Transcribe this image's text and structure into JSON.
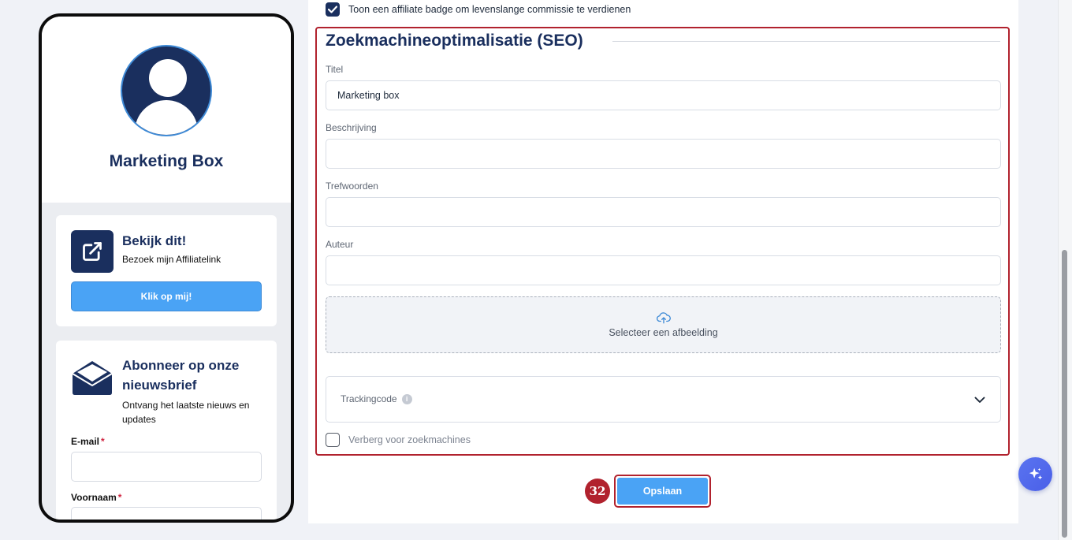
{
  "preview": {
    "brand_name": "Marketing Box",
    "link_card": {
      "title": "Bekijk dit!",
      "subtitle": "Bezoek mijn Affiliatelink",
      "button_label": "Klik op mij!",
      "icon": "external-link-icon"
    },
    "newsletter": {
      "title": "Abonneer op onze nieuwsbrief",
      "subtitle": "Ontvang het laatste nieuws en updates",
      "icon": "envelope-icon",
      "email_label": "E-mail",
      "firstname_label": "Voornaam",
      "required_mark": "*"
    }
  },
  "settings": {
    "affiliate_badge": {
      "label": "Toon een affiliate badge om levenslange commissie te verdienen",
      "checked": true
    },
    "seo": {
      "section_title": "Zoekmachineoptimalisatie (SEO)",
      "title_label": "Titel",
      "title_value": "Marketing box",
      "description_label": "Beschrijving",
      "description_value": "",
      "keywords_label": "Trefwoorden",
      "keywords_value": "",
      "author_label": "Auteur",
      "author_value": "",
      "upload_label": "Selecteer een afbeelding",
      "tracking_label": "Trackingcode",
      "info_glyph": "i",
      "hide_label": "Verberg voor zoekmachines",
      "hide_checked": false
    }
  },
  "actions": {
    "step_number": "32",
    "save_label": "Opslaan"
  },
  "colors": {
    "navy": "#1a2f5e",
    "accent_blue": "#4aa3f5",
    "highlight_red": "#b1222e"
  }
}
